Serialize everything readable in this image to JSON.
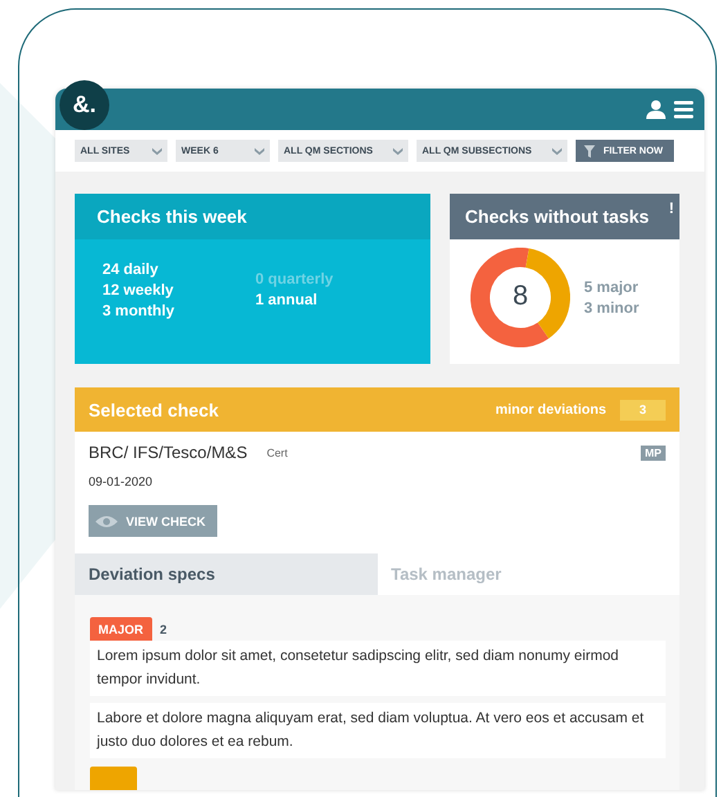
{
  "header": {
    "logo": "&."
  },
  "filters": [
    {
      "label": "ALL SITES",
      "kind": "dropdown"
    },
    {
      "label": "WEEK 6",
      "kind": "dropdown"
    },
    {
      "label": "ALL QM SECTIONS",
      "kind": "dropdown"
    },
    {
      "label": "ALL QM SUBSECTIONS",
      "kind": "dropdown"
    },
    {
      "label": "FILTER NOW",
      "kind": "button"
    }
  ],
  "checks_this_week": {
    "title": "Checks this week",
    "columns": [
      [
        {
          "text": "24 daily",
          "disabled": false
        },
        {
          "text": "12 weekly",
          "disabled": false
        },
        {
          "text": "3 monthly",
          "disabled": false
        }
      ],
      [
        {
          "text": "0 quarterly",
          "disabled": true
        },
        {
          "text": "1 annual",
          "disabled": false
        }
      ]
    ]
  },
  "checks_without_tasks": {
    "title": "Checks without tasks",
    "alert": "!",
    "total": "8",
    "legend": [
      "5 major",
      "3 minor"
    ]
  },
  "selected_check": {
    "title": "Selected check",
    "deviation_label": "minor deviations",
    "deviation_count": "3",
    "name": "BRC/ IFS/Tesco/M&S",
    "type": "Cert",
    "badge": "MP",
    "date": "09-01-2020",
    "button": "VIEW CHECK"
  },
  "tabs": [
    {
      "label": "Deviation specs",
      "selected": true
    },
    {
      "label": "Task manager",
      "selected": false
    }
  ],
  "deviations": [
    {
      "kind": "major",
      "label": "MAJOR",
      "count": "2",
      "items": [
        "Lorem ipsum dolor sit amet, consetetur sadipscing elitr, sed diam nonumy eirmod tempor invidunt.",
        "Labore et dolore magna aliquyam erat, sed diam voluptua. At vero eos et accusam et justo duo dolores et ea rebum."
      ]
    },
    {
      "kind": "minor"
    }
  ]
}
